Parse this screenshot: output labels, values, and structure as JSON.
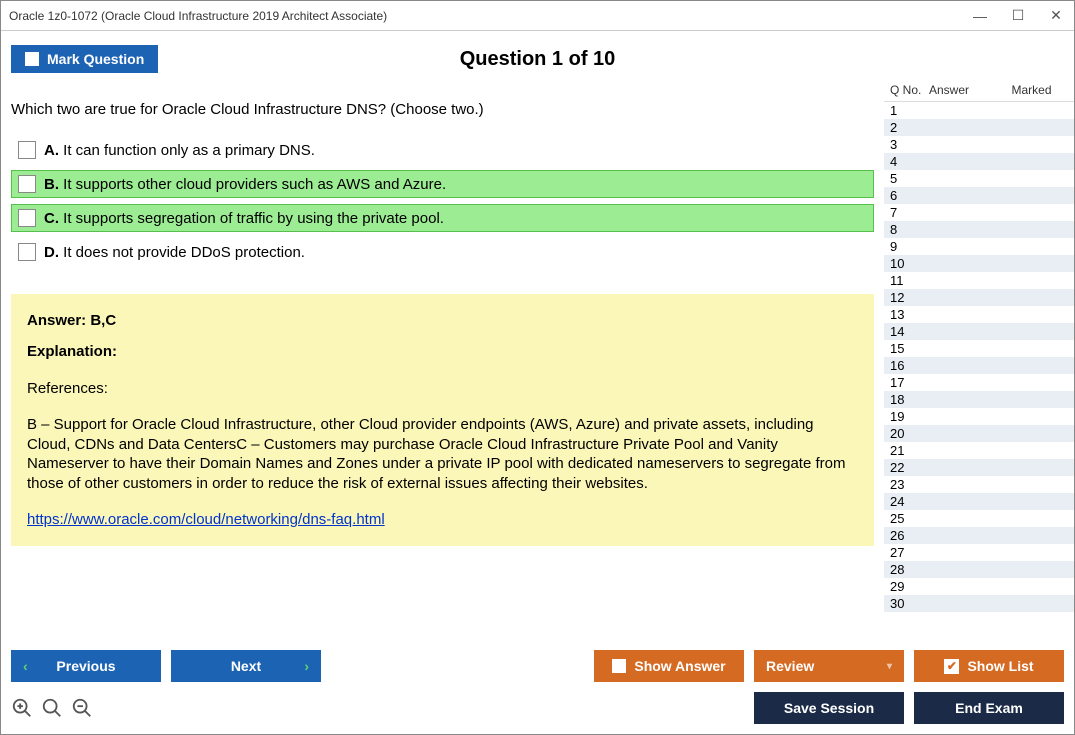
{
  "window": {
    "title": "Oracle 1z0-1072 (Oracle Cloud Infrastructure 2019 Architect Associate)"
  },
  "header": {
    "mark_label": "Mark Question",
    "question_heading": "Question 1 of 10"
  },
  "question": {
    "text": "Which two are true for Oracle Cloud Infrastructure DNS? (Choose two.)",
    "options": [
      {
        "letter": "A.",
        "text": "It can function only as a primary DNS.",
        "correct": false
      },
      {
        "letter": "B.",
        "text": "It supports other cloud providers such as AWS and Azure.",
        "correct": true
      },
      {
        "letter": "C.",
        "text": "It supports segregation of traffic by using the private pool.",
        "correct": true
      },
      {
        "letter": "D.",
        "text": "It does not provide DDoS protection.",
        "correct": false
      }
    ]
  },
  "answer": {
    "answer_label": "Answer: B,C",
    "explanation_label": "Explanation:",
    "references_label": "References:",
    "body": "B – Support for Oracle Cloud Infrastructure, other Cloud provider endpoints (AWS, Azure) and private assets, including Cloud, CDNs and Data CentersC – Customers may purchase Oracle Cloud Infrastructure Private Pool and Vanity Nameserver to have their Domain Names and Zones under a private IP pool with dedicated nameservers to segregate from those of other customers in order to reduce the risk of external issues affecting their websites.",
    "link": "https://www.oracle.com/cloud/networking/dns-faq.html"
  },
  "sidebar": {
    "headers": {
      "q": "Q No.",
      "a": "Answer",
      "m": "Marked"
    },
    "rows": [
      {
        "q": "1"
      },
      {
        "q": "2"
      },
      {
        "q": "3"
      },
      {
        "q": "4"
      },
      {
        "q": "5"
      },
      {
        "q": "6"
      },
      {
        "q": "7"
      },
      {
        "q": "8"
      },
      {
        "q": "9"
      },
      {
        "q": "10"
      },
      {
        "q": "11"
      },
      {
        "q": "12"
      },
      {
        "q": "13"
      },
      {
        "q": "14"
      },
      {
        "q": "15"
      },
      {
        "q": "16"
      },
      {
        "q": "17"
      },
      {
        "q": "18"
      },
      {
        "q": "19"
      },
      {
        "q": "20"
      },
      {
        "q": "21"
      },
      {
        "q": "22"
      },
      {
        "q": "23"
      },
      {
        "q": "24"
      },
      {
        "q": "25"
      },
      {
        "q": "26"
      },
      {
        "q": "27"
      },
      {
        "q": "28"
      },
      {
        "q": "29"
      },
      {
        "q": "30"
      }
    ]
  },
  "footer": {
    "previous": "Previous",
    "next": "Next",
    "show_answer": "Show Answer",
    "review": "Review",
    "show_list": "Show List",
    "save_session": "Save Session",
    "end_exam": "End Exam"
  }
}
